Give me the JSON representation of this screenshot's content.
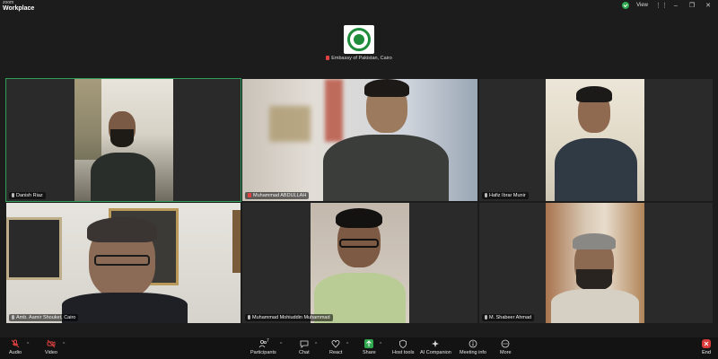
{
  "window": {
    "brand_top": "zoom",
    "brand_name": "Workplace",
    "view_label": "View"
  },
  "banner": {
    "name": "Embassy of Pakistan, Cairo"
  },
  "tiles": [
    {
      "name": "Danish Riaz"
    },
    {
      "name": "Muhammad ABDULLAH"
    },
    {
      "name": "Hafiz Ibrar Munir"
    },
    {
      "name": "Amb. Aamir Shouket, Cairo"
    },
    {
      "name": "Muhammad Mohiuddin Muhammad"
    },
    {
      "name": "M. Shabeer Ahmad"
    }
  ],
  "participants_count": "7",
  "toolbar": {
    "audio": "Audio",
    "video": "Video",
    "participants": "Participants",
    "chat": "Chat",
    "react": "React",
    "share": "Share",
    "host_tools": "Host tools",
    "ai_companion": "AI Companion",
    "meeting_info": "Meeting info",
    "more": "More",
    "end": "End"
  },
  "icons": {
    "security": "shield-check-icon",
    "audio": "mic-muted-icon",
    "video": "camera-off-icon",
    "participants": "people-icon",
    "chat": "chat-bubble-icon",
    "react": "heart-icon",
    "share": "share-arrow-icon",
    "host_tools": "shield-icon",
    "ai_companion": "sparkle-icon",
    "meeting_info": "info-icon",
    "more": "ellipsis-icon",
    "end": "end-call-icon"
  },
  "colors": {
    "active_speaker_border": "#2e9d58",
    "mute_red": "#e04141",
    "share_green": "#2fa84f",
    "end_red": "#d93a3a"
  }
}
